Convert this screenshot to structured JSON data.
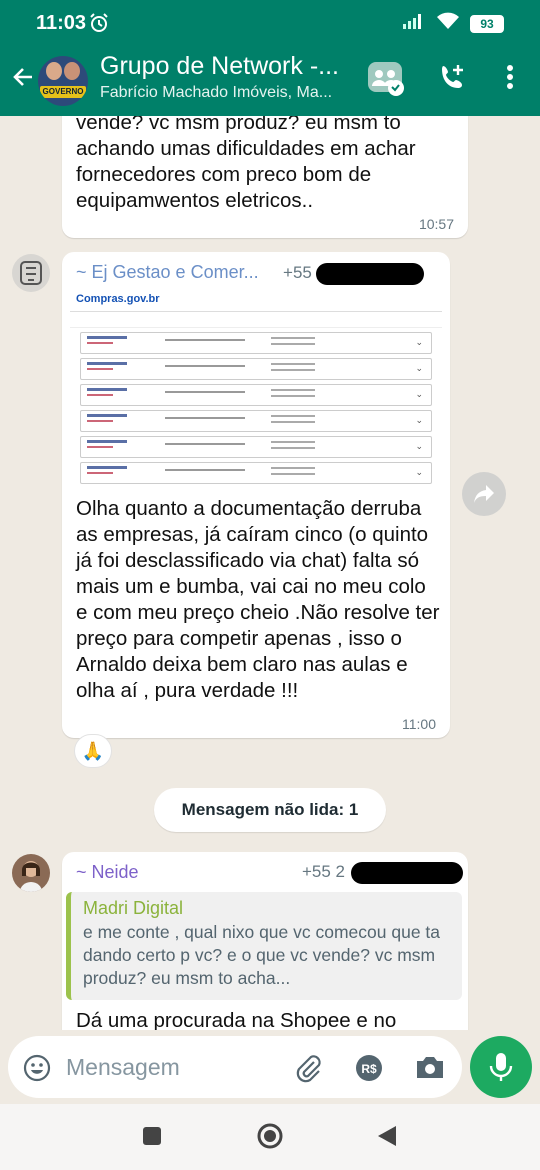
{
  "status_bar": {
    "time": "11:03",
    "battery": "93"
  },
  "header": {
    "title": "Grupo de Network -...",
    "subtitle": "Fabrício Machado Imóveis, Ma...",
    "avatar_banner": "GOVERNO"
  },
  "messages": {
    "m1": {
      "text": "que ta dando certo p vc? e o que vc vende? vc msm produz? eu msm to achando umas dificuldades em achar fornecedores com preco bom de equipamwentos eletricos..",
      "time": "10:57"
    },
    "m2": {
      "sender": "~ Ej Gestao e Comer...",
      "phone": "+55",
      "thumb_logo": "Compras.gov.br",
      "text": "Olha quanto a documentação derruba as empresas, já caíram cinco (o quinto já foi desclassificado via chat) falta só mais um e bumba, vai cai no meu colo e  com meu preço cheio .Não resolve ter preço para competir apenas , isso o Arnaldo deixa bem claro nas aulas e olha aí , pura verdade !!!",
      "time": "11:00",
      "reaction": "🙏"
    },
    "unread_label": "Mensagem não lida: 1",
    "m3": {
      "sender": "~ Neide",
      "phone": "+55 2",
      "quote_author": "Madri Digital",
      "quote_text": "e me conte , qual nixo que vc comecou que ta dando certo p vc? e o que vc vende? vc msm produz? eu msm to acha...",
      "text": "Dá uma procurada na Shopee e no"
    }
  },
  "composer": {
    "placeholder": "Mensagem"
  },
  "colors": {
    "primary": "#008069",
    "chat_bg": "#efeae2",
    "mic": "#1daa61"
  }
}
